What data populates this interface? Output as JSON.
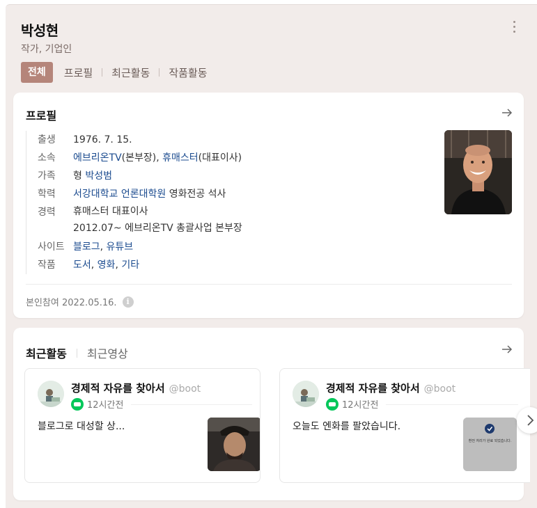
{
  "person": {
    "name": "박성현",
    "subtitle": "작가, 기업인"
  },
  "tabs": [
    {
      "label": "전체",
      "active": true
    },
    {
      "label": "프로필"
    },
    {
      "label": "최근활동"
    },
    {
      "label": "작품활동"
    }
  ],
  "profile": {
    "title": "프로필",
    "rows": {
      "birth": {
        "label": "출생",
        "value": "1976. 7. 15."
      },
      "affiliation": {
        "label": "소속",
        "link1": "에브리온TV",
        "text1": "(본부장), ",
        "link2": "휴매스터",
        "text2": "(대표이사)"
      },
      "family": {
        "label": "가족",
        "text": "형 ",
        "link": "박성범"
      },
      "education": {
        "label": "학력",
        "link": "서강대학교 언론대학원",
        "text": " 영화전공 석사"
      },
      "career": {
        "label": "경력",
        "line1": "휴매스터 대표이사",
        "line2": "2012.07~ 에브리온TV 총괄사업 본부장"
      },
      "site": {
        "label": "사이트",
        "link1": "블로그",
        "sep": ", ",
        "link2": "유튜브"
      },
      "works": {
        "label": "작품",
        "link1": "도서",
        "sep1": ", ",
        "link2": "영화",
        "sep2": ", ",
        "link3": "기타"
      }
    },
    "verified": "본인참여 2022.05.16.",
    "info_icon": "i"
  },
  "activity": {
    "tab_active": "최근활동",
    "tab_inactive": "최근영상",
    "posts": [
      {
        "blog": "경제적 자유를 찾아서",
        "handle": "@boot",
        "time": "12시간전",
        "text": "블로그로 대성할 상..."
      },
      {
        "blog": "경제적 자유를 찾아서",
        "handle": "@boot",
        "time": "12시간전",
        "text": "오늘도 엔화를 팔았습니다.",
        "thumb_caption": "환전 처리가 완료 되었습니다."
      }
    ]
  },
  "colors": {
    "accent": "#b5857a",
    "link": "#1b4b8f",
    "naver_green": "#03c75a",
    "frame_bg": "#f2ecea"
  }
}
